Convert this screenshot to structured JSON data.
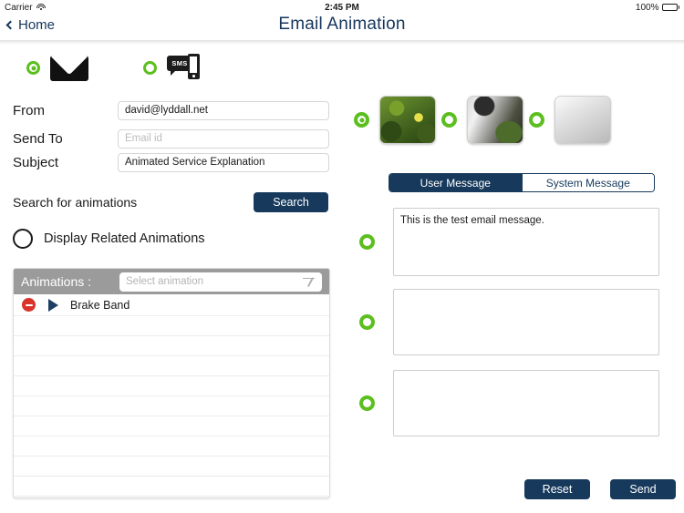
{
  "statusbar": {
    "carrier": "Carrier",
    "time": "2:45 PM",
    "battery": "100%",
    "wifi_icon": "wifi-icon",
    "battery_icon": "battery-full-icon"
  },
  "navbar": {
    "back_label": "Home",
    "back_icon": "chevron-left-icon",
    "title": "Email Animation"
  },
  "channels": {
    "email": {
      "label": "email-channel",
      "icon": "envelope-icon",
      "selected": true
    },
    "sms": {
      "label": "SMS",
      "icon": "sms-icon",
      "selected": false
    }
  },
  "form": {
    "fields": [
      {
        "label": "From",
        "value": "david@lyddall.net",
        "placeholder": ""
      },
      {
        "label": "Send To",
        "value": "",
        "placeholder": "Email id"
      },
      {
        "label": "Subject",
        "value": "Animated Service Explanation",
        "placeholder": ""
      }
    ],
    "search_label": "Search for animations",
    "search_button": "Search",
    "display_related_label": "Display Related Animations",
    "display_related_checked": false
  },
  "animations": {
    "header_label": "Animations :",
    "select_placeholder": "Select animation",
    "dropdown_icon": "chevron-down-icon",
    "rows": [
      {
        "title": "Brake Band",
        "delete_icon": "delete-minus-icon",
        "play_icon": "play-icon"
      },
      {
        "title": ""
      },
      {
        "title": ""
      },
      {
        "title": ""
      },
      {
        "title": ""
      },
      {
        "title": ""
      },
      {
        "title": ""
      },
      {
        "title": ""
      },
      {
        "title": ""
      },
      {
        "title": ""
      },
      {
        "title": ""
      }
    ]
  },
  "media": {
    "thumbnails": [
      {
        "name": "leaves-thumbnail",
        "selected": true
      },
      {
        "name": "waterfall-thumbnail",
        "selected": false
      },
      {
        "name": "empty-thumbnail",
        "selected": false
      }
    ]
  },
  "message": {
    "tabs": [
      {
        "label": "User Message",
        "active": true
      },
      {
        "label": "System Message",
        "active": false
      }
    ],
    "boxes": [
      {
        "value": "This is the test email message.",
        "selected": false
      },
      {
        "value": "",
        "selected": false
      },
      {
        "value": "",
        "selected": false
      }
    ]
  },
  "actions": {
    "reset_label": "Reset",
    "send_label": "Send"
  },
  "colors": {
    "navy": "#16395c",
    "green": "#5cbf1f",
    "red": "#d9342b",
    "gray_header": "#9b9b9b"
  }
}
